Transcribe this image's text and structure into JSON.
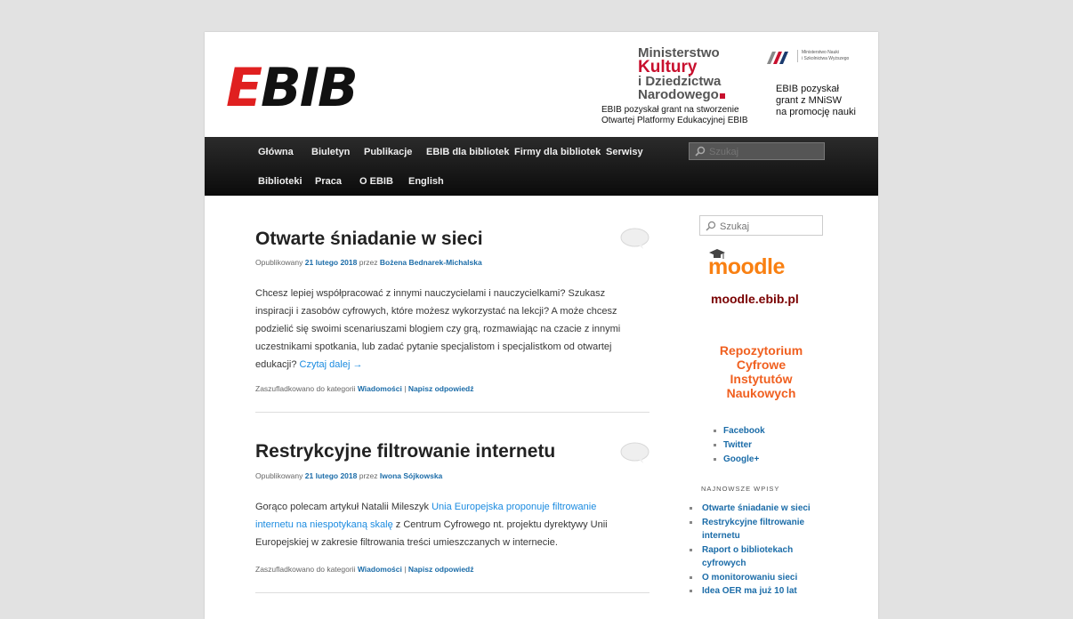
{
  "header": {
    "logo_text_e": "E",
    "logo_text_rest": "BIB",
    "mkidn": {
      "line1": "Ministerstwo",
      "line2": "Kultury",
      "line3": "i Dziedzictwa",
      "line4": "Narodowego"
    },
    "grant1_line1": "EBIB pozyskał grant na stworzenie",
    "grant1_line2": "Otwartej Platformy Edukacyjnej EBIB",
    "mnisw_logo_line1": "Ministerstwo Nauki",
    "mnisw_logo_line2": "i Szkolnictwa Wyższego",
    "grant2_line1": "EBIB pozyskał",
    "grant2_line2": "grant z MNiSW",
    "grant2_line3": "na promocję nauki"
  },
  "nav": {
    "row1": [
      "Główna",
      "Biuletyn",
      "Publikacje",
      "EBIB dla bibliotek",
      "Firmy dla bibliotek",
      "Serwisy"
    ],
    "row2": [
      "Biblioteki",
      "Praca",
      "O EBIB",
      "English"
    ],
    "search_placeholder": "Szukaj"
  },
  "posts": [
    {
      "title": "Otwarte śniadanie w sieci",
      "meta_prefix": "Opublikowany",
      "date": "21 lutego 2018",
      "by": "przez",
      "author": "Bożena Bednarek-Michalska",
      "excerpt_lines": [
        "Chcesz lepiej współpracować z innymi nauczycielami i nauczycielkami? Szukasz",
        "inspiracji i zasobów cyfrowych, które możesz wykorzystać na lekcji? A może chcesz",
        "podzielić się swoimi scenariuszami blogiem czy grą, rozmawiając na czacie z innymi",
        "uczestnikami spotkania, lub zadać pytanie specjalistom i specjalistkom od otwartej",
        "edukacji?"
      ],
      "read_more": "Czytaj dalej →",
      "cats_prefix": "Zaszufladkowano do kategorii",
      "category": "Wiadomości",
      "sep": "|",
      "reply": "Napisz odpowiedź"
    },
    {
      "title": "Restrykcyjne filtrowanie internetu",
      "meta_prefix": "Opublikowany",
      "date": "21 lutego 2018",
      "by": "przez",
      "author": "Iwona Sójkowska",
      "excerpt_a": "Gorąco polecam artykuł Natalii Mileszyk",
      "excerpt_link1": "Unia Europejska proponuje filtrowanie",
      "excerpt_link2": "internetu na niespotykaną skalę",
      "excerpt_b": "z Centrum Cyfrowego nt. projektu dyrektywy Unii",
      "excerpt_c": "Europejskiej w zakresie filtrowania treści umieszczanych w internecie.",
      "cats_prefix": "Zaszufladkowano do kategorii",
      "category": "Wiadomości",
      "sep": "|",
      "reply": "Napisz odpowiedź"
    }
  ],
  "sidebar": {
    "search_placeholder": "Szukaj",
    "moodle_logo": "moodle",
    "moodle_url": "moodle.ebib.pl",
    "repo_lines": [
      "Repozytorium",
      "Cyfrowe",
      "Instytutów",
      "Naukowych"
    ],
    "social": [
      "Facebook",
      "Twitter",
      "Google+"
    ],
    "recent_heading": "NAJNOWSZE WPISY",
    "recent": [
      "Otwarte śniadanie w sieci",
      "Restrykcyjne filtrowanie internetu",
      "Raport o bibliotekach cyfrowych",
      "O monitorowaniu sieci",
      "Idea OER ma już 10 lat"
    ]
  }
}
